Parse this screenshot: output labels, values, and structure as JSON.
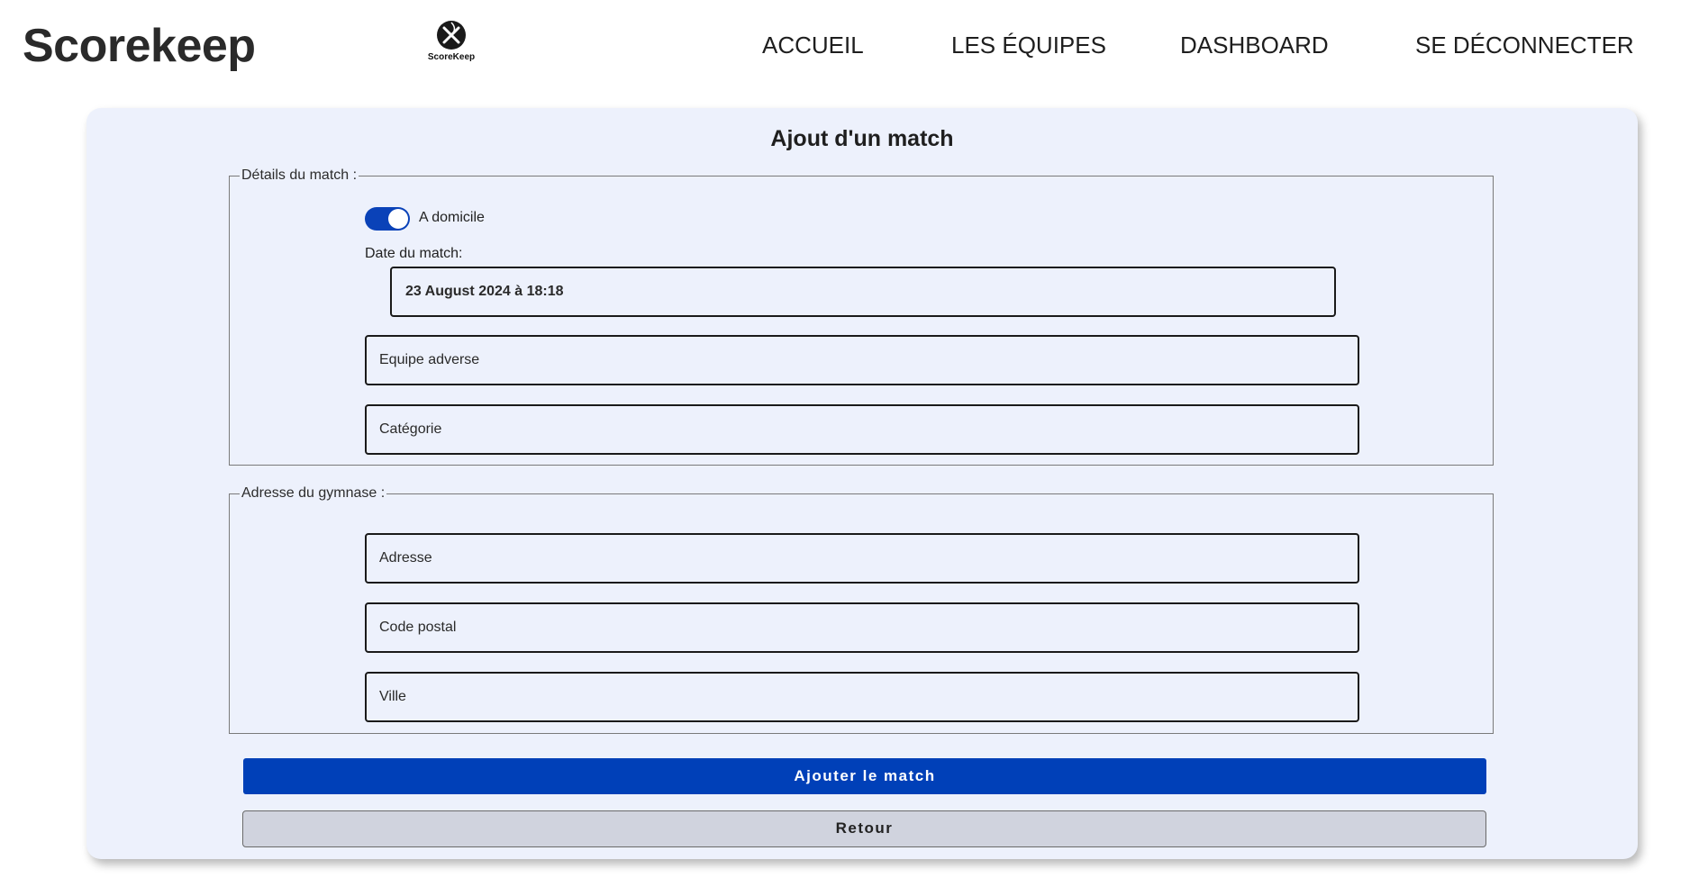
{
  "header": {
    "brand": "Scorekeep",
    "logo_text": "ScoreKeep",
    "logo_icon": "x-ball-icon",
    "nav": [
      {
        "label": "ACCUEIL"
      },
      {
        "label": "LES ÉQUIPES"
      },
      {
        "label": "DASHBOARD"
      },
      {
        "label": "SE DÉCONNECTER"
      }
    ]
  },
  "form": {
    "title": "Ajout d'un match",
    "details_legend": "Détails du match :",
    "home_toggle": {
      "label": "A domicile",
      "checked": true
    },
    "date_label": "Date du match:",
    "date_value": "23 August 2024 à 18:18",
    "opponent_placeholder": "Equipe adverse",
    "category_placeholder": "Catégorie",
    "address_legend": "Adresse du gymnase :",
    "address_placeholder": "Adresse",
    "postal_placeholder": "Code postal",
    "city_placeholder": "Ville",
    "submit_label": "Ajouter le match",
    "back_label": "Retour"
  },
  "colors": {
    "accent": "#0040b8",
    "card_bg": "#edf1fc",
    "secondary_btn": "#d0d3de"
  }
}
